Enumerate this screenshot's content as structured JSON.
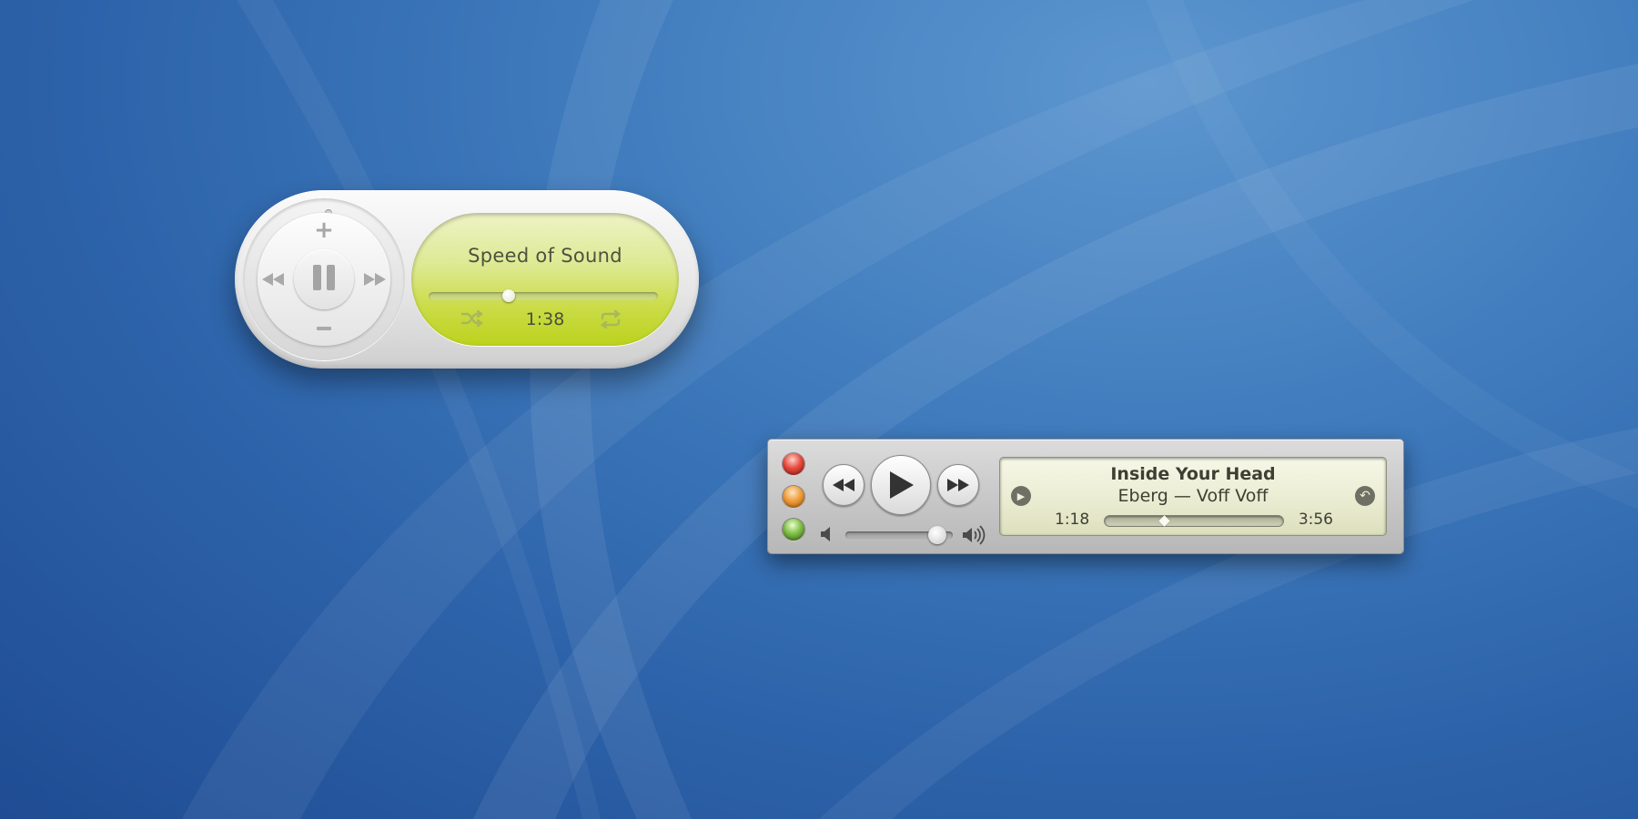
{
  "desktop": {
    "colors": {
      "wallpaper_top": "#5d96cf",
      "wallpaper_bottom": "#1f4c93"
    }
  },
  "mini_remote": {
    "controls": {
      "volume_up_icon": "plus-icon",
      "volume_down_icon": "minus-icon",
      "previous_icon": "rewind-icon",
      "next_icon": "fast-forward-icon",
      "play_pause_icon": "pause-icon"
    },
    "now_playing": {
      "title": "Speed of Sound",
      "time": "1:38",
      "progress": 0.35
    },
    "shuffle_icon": "shuffle-icon",
    "repeat_icon": "repeat-icon",
    "colors": {
      "lcd": "#cbdc49",
      "body": "#e7e7e7"
    }
  },
  "classic_player": {
    "window_buttons": [
      "close",
      "minimize",
      "zoom"
    ],
    "colors": {
      "close": "#e5493d",
      "minimize": "#ef9c3c",
      "zoom": "#7fbd46",
      "display": "#e9ebd0"
    },
    "transport": {
      "rewind_icon": "rewind-icon",
      "play_icon": "play-icon",
      "forward_icon": "fast-forward-icon"
    },
    "volume": {
      "level": 0.86,
      "low_icon": "speaker-low-icon",
      "high_icon": "speaker-high-icon"
    },
    "display": {
      "title": "Inside Your Head",
      "artist_album": "Eberg — Voff Voff",
      "elapsed": "1:18",
      "total": "3:56",
      "progress": 0.33
    }
  }
}
